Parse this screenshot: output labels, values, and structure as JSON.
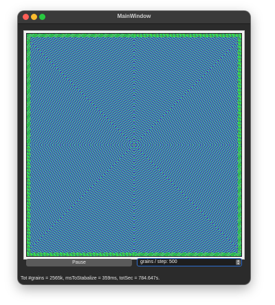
{
  "window": {
    "title": "MainWindow"
  },
  "canvas": {
    "description_colors": [
      "#1414d8",
      "#3ce0e0",
      "#38d838",
      "#8a2ea8"
    ],
    "background": "#1a1aa0"
  },
  "controls": {
    "pause_label": "Pause",
    "spinbox_value": "grains / step: 500",
    "spin_up_icon": "arrow-up-icon",
    "spin_down_icon": "arrow-down-icon"
  },
  "status": {
    "text": "Tot #grains = 2565k, msToStabalize = 359ms, totSec = 784.647s."
  },
  "colors": {
    "window_bg": "#2b2b2b",
    "titlebar_bg": "#3a3a3a",
    "accent": "#2f6fd0",
    "close": "#ff5f57",
    "minimize": "#febc2e",
    "maximize": "#28c840"
  }
}
